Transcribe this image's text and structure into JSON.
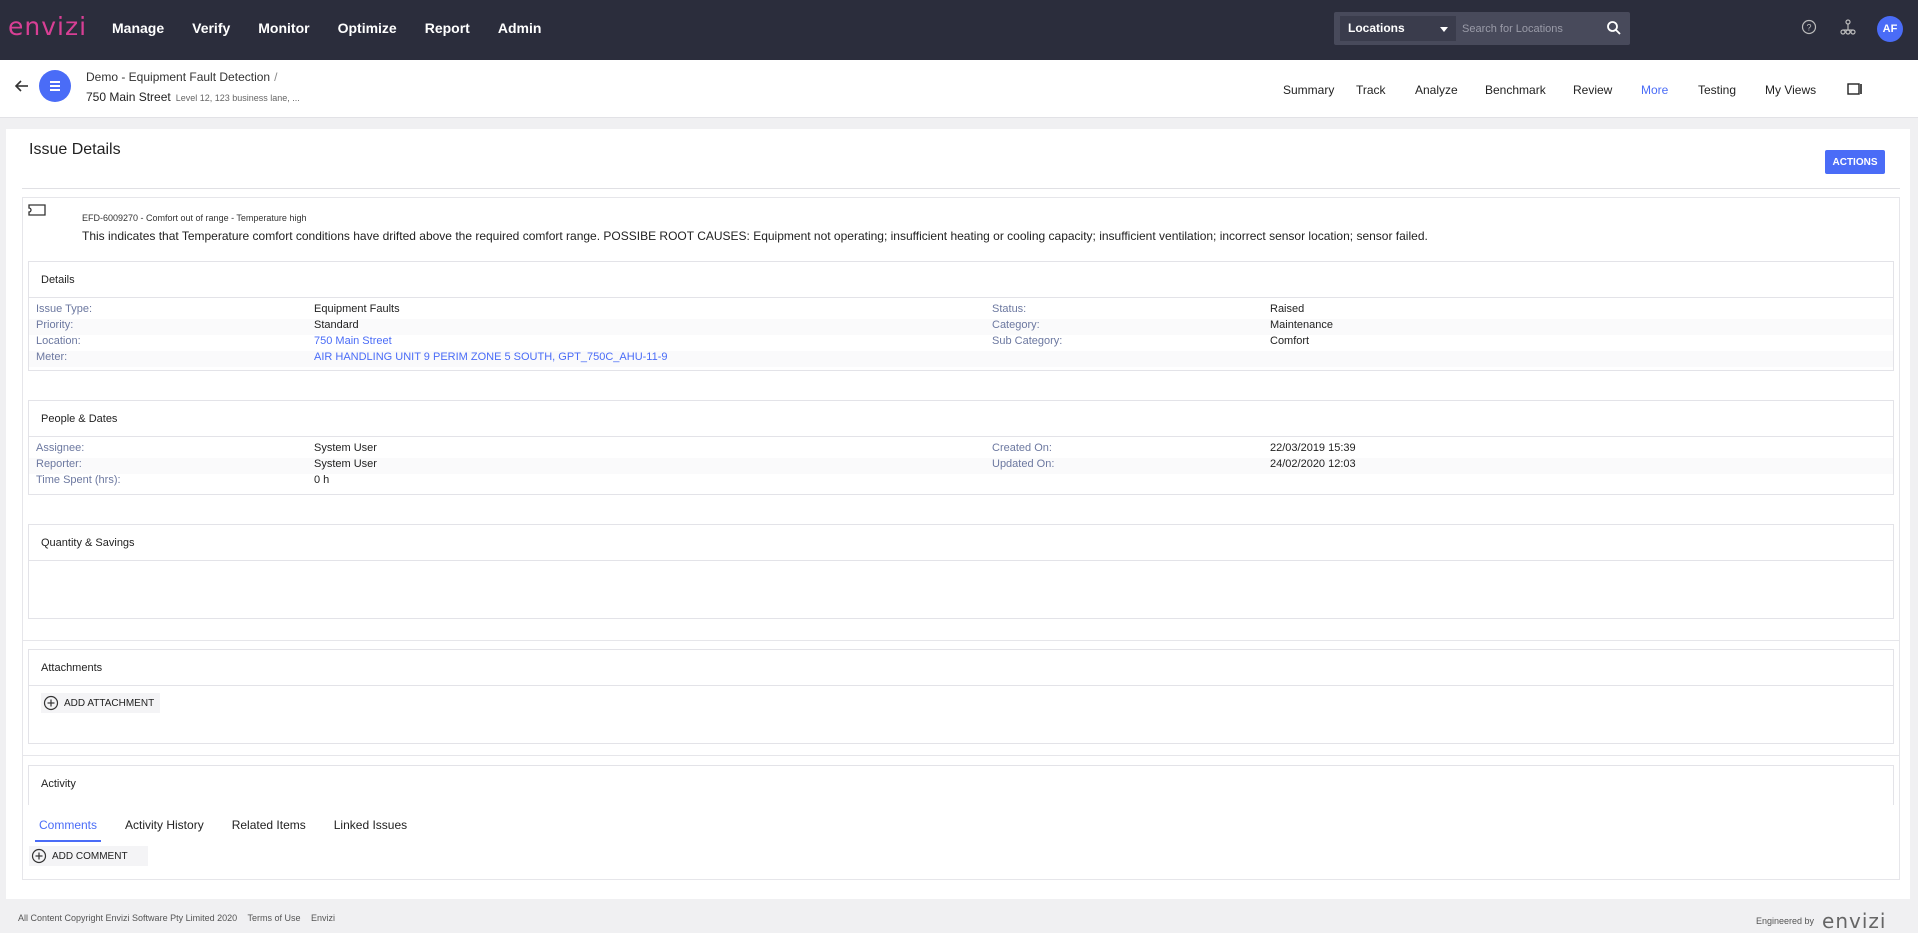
{
  "brand": {
    "logo": "envizi",
    "accent": "#4a6cf7",
    "nav_bg": "#2b2d3c"
  },
  "nav": {
    "items": [
      "Manage",
      "Verify",
      "Monitor",
      "Optimize",
      "Report",
      "Admin"
    ]
  },
  "search": {
    "scope": "Locations",
    "placeholder": "Search for Locations"
  },
  "user": {
    "initials": "AF"
  },
  "breadcrumb": {
    "group": "Demo - Equipment Fault Detection",
    "separator": "/",
    "location": "750 Main Street",
    "address": "Level 12, 123 business lane, ..."
  },
  "tabs": [
    "Summary",
    "Track",
    "Analyze",
    "Benchmark",
    "Review",
    "More",
    "Testing",
    "My Views"
  ],
  "page": {
    "title": "Issue Details",
    "actions_label": "ACTIONS"
  },
  "issue": {
    "id_line": "EFD-6009270 - Comfort out of range - Temperature high",
    "description": "This indicates that Temperature comfort conditions have drifted above the required comfort range. POSSIBE ROOT CAUSES: Equipment not operating; insufficient heating or cooling capacity; insufficient ventilation; incorrect sensor location; sensor failed."
  },
  "details": {
    "title": "Details",
    "left": [
      {
        "label": "Issue Type:",
        "value": "Equipment Faults"
      },
      {
        "label": "Priority:",
        "value": "Standard"
      },
      {
        "label": "Location:",
        "value": "750 Main Street"
      },
      {
        "label": "Meter:",
        "value": "AIR HANDLING UNIT 9 PERIM ZONE 5 SOUTH, GPT_750C_AHU-11-9"
      }
    ],
    "right": [
      {
        "label": "Status:",
        "value": "Raised"
      },
      {
        "label": "Category:",
        "value": "Maintenance"
      },
      {
        "label": "Sub Category:",
        "value": "Comfort"
      }
    ]
  },
  "people": {
    "title": "People & Dates",
    "left": [
      {
        "label": "Assignee:",
        "value": "System User"
      },
      {
        "label": "Reporter:",
        "value": "System User"
      },
      {
        "label": "Time Spent (hrs):",
        "value": "0 h"
      }
    ],
    "right": [
      {
        "label": "Created On:",
        "value": "22/03/2019 15:39"
      },
      {
        "label": "Updated On:",
        "value": "24/02/2020 12:03"
      }
    ]
  },
  "quantity": {
    "title": "Quantity & Savings"
  },
  "attachments": {
    "title": "Attachments",
    "add_label": "ADD ATTACHMENT"
  },
  "activity": {
    "title": "Activity",
    "tabs": [
      "Comments",
      "Activity History",
      "Related Items",
      "Linked Issues"
    ],
    "add_label": "ADD COMMENT"
  },
  "footer": {
    "copyright": "All Content Copyright Envizi Software Pty Limited 2020",
    "terms": "Terms of Use",
    "envizi_link": "Envizi",
    "engineered_by": "Engineered by",
    "footer_logo": "envizi"
  }
}
